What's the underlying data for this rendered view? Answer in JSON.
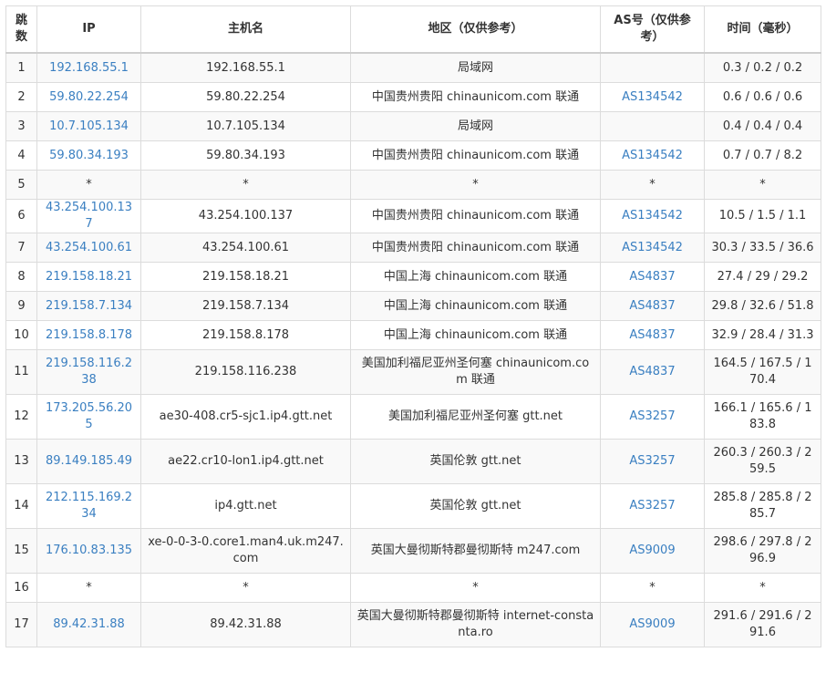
{
  "colors": {
    "link": "#3a7fc1",
    "border": "#dcdcdc",
    "zebra": "#f9f9f9"
  },
  "headers": {
    "hop": "跳数",
    "ip": "IP",
    "host": "主机名",
    "loc": "地区（仅供参考）",
    "as": "AS号（仅供参考）",
    "time": "时间（毫秒）"
  },
  "rows": [
    {
      "hop": "1",
      "ip": "192.168.55.1",
      "host": "192.168.55.1",
      "loc": "局域网",
      "as": "",
      "time": "0.3 / 0.2 / 0.2"
    },
    {
      "hop": "2",
      "ip": "59.80.22.254",
      "host": "59.80.22.254",
      "loc": "中国贵州贵阳 chinaunicom.com 联通",
      "as": "AS134542",
      "time": "0.6 / 0.6 / 0.6"
    },
    {
      "hop": "3",
      "ip": "10.7.105.134",
      "host": "10.7.105.134",
      "loc": "局域网",
      "as": "",
      "time": "0.4 / 0.4 / 0.4"
    },
    {
      "hop": "4",
      "ip": "59.80.34.193",
      "host": "59.80.34.193",
      "loc": "中国贵州贵阳 chinaunicom.com 联通",
      "as": "AS134542",
      "time": "0.7 / 0.7 / 8.2"
    },
    {
      "hop": "5",
      "ip": "*",
      "host": "*",
      "loc": "*",
      "as": "*",
      "time": "*"
    },
    {
      "hop": "6",
      "ip": "43.254.100.137",
      "host": "43.254.100.137",
      "loc": "中国贵州贵阳 chinaunicom.com 联通",
      "as": "AS134542",
      "time": "10.5 / 1.5 / 1.1"
    },
    {
      "hop": "7",
      "ip": "43.254.100.61",
      "host": "43.254.100.61",
      "loc": "中国贵州贵阳 chinaunicom.com 联通",
      "as": "AS134542",
      "time": "30.3 / 33.5 / 36.6"
    },
    {
      "hop": "8",
      "ip": "219.158.18.21",
      "host": "219.158.18.21",
      "loc": "中国上海 chinaunicom.com 联通",
      "as": "AS4837",
      "time": "27.4 / 29 / 29.2"
    },
    {
      "hop": "9",
      "ip": "219.158.7.134",
      "host": "219.158.7.134",
      "loc": "中国上海 chinaunicom.com 联通",
      "as": "AS4837",
      "time": "29.8 / 32.6 / 51.8"
    },
    {
      "hop": "10",
      "ip": "219.158.8.178",
      "host": "219.158.8.178",
      "loc": "中国上海 chinaunicom.com 联通",
      "as": "AS4837",
      "time": "32.9 / 28.4 / 31.3"
    },
    {
      "hop": "11",
      "ip": "219.158.116.238",
      "host": "219.158.116.238",
      "loc": "美国加利福尼亚州圣何塞 chinaunicom.com 联通",
      "as": "AS4837",
      "time": "164.5 / 167.5 / 170.4"
    },
    {
      "hop": "12",
      "ip": "173.205.56.205",
      "host": "ae30-408.cr5-sjc1.ip4.gtt.net",
      "loc": "美国加利福尼亚州圣何塞 gtt.net",
      "as": "AS3257",
      "time": "166.1 / 165.6 / 183.8"
    },
    {
      "hop": "13",
      "ip": "89.149.185.49",
      "host": "ae22.cr10-lon1.ip4.gtt.net",
      "loc": "英国伦敦 gtt.net",
      "as": "AS3257",
      "time": "260.3 / 260.3 / 259.5"
    },
    {
      "hop": "14",
      "ip": "212.115.169.234",
      "host": "ip4.gtt.net",
      "loc": "英国伦敦 gtt.net",
      "as": "AS3257",
      "time": "285.8 / 285.8 / 285.7"
    },
    {
      "hop": "15",
      "ip": "176.10.83.135",
      "host": "xe-0-0-3-0.core1.man4.uk.m247.com",
      "loc": "英国大曼彻斯特郡曼彻斯特 m247.com",
      "as": "AS9009",
      "time": "298.6 / 297.8 / 296.9"
    },
    {
      "hop": "16",
      "ip": "*",
      "host": "*",
      "loc": "*",
      "as": "*",
      "time": "*"
    },
    {
      "hop": "17",
      "ip": "89.42.31.88",
      "host": "89.42.31.88",
      "loc": "英国大曼彻斯特郡曼彻斯特 internet-constanta.ro",
      "as": "AS9009",
      "time": "291.6 / 291.6 / 291.6"
    }
  ]
}
